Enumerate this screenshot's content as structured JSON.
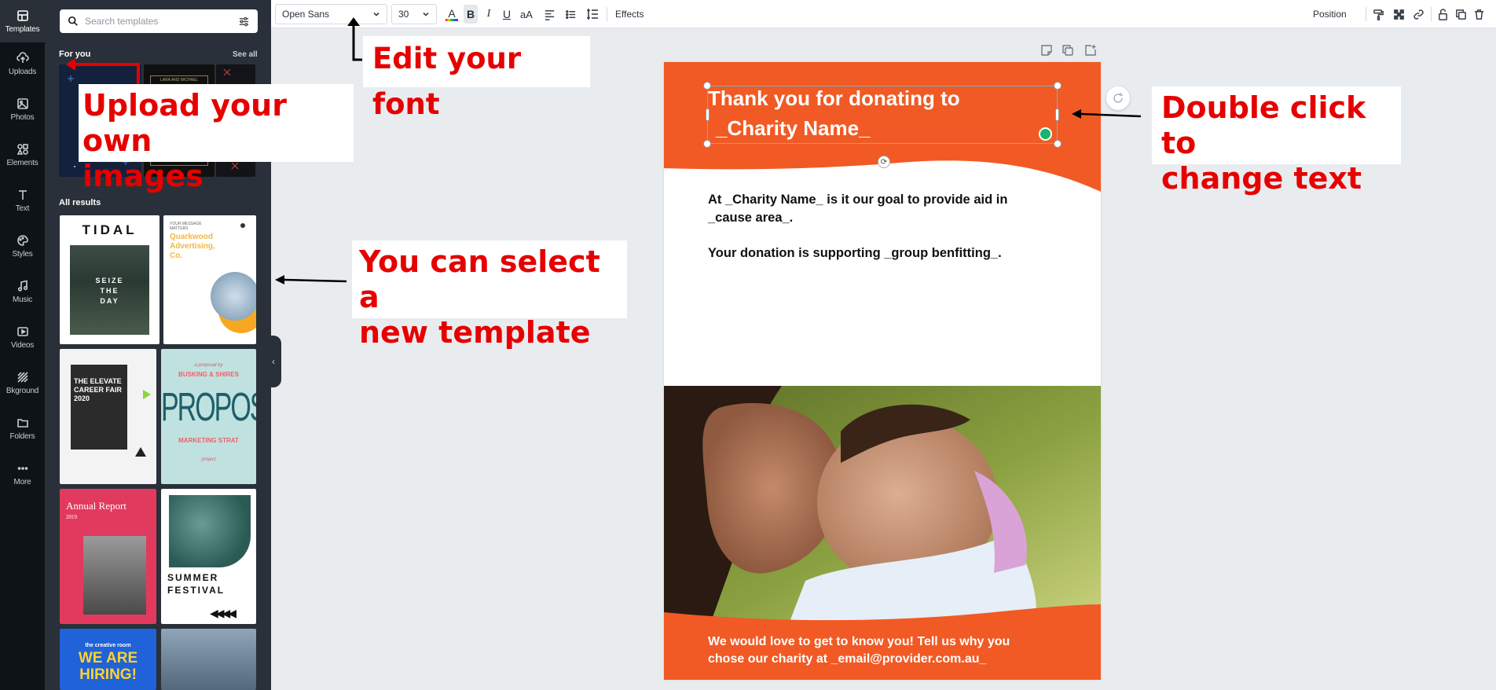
{
  "rail": {
    "items": [
      {
        "label": "Templates",
        "icon": "templates-icon"
      },
      {
        "label": "Uploads",
        "icon": "upload-icon"
      },
      {
        "label": "Photos",
        "icon": "photo-icon"
      },
      {
        "label": "Elements",
        "icon": "shapes-icon"
      },
      {
        "label": "Text",
        "icon": "text-icon"
      },
      {
        "label": "Styles",
        "icon": "palette-icon"
      },
      {
        "label": "Music",
        "icon": "music-icon"
      },
      {
        "label": "Videos",
        "icon": "video-icon"
      },
      {
        "label": "Bkground",
        "icon": "background-icon"
      },
      {
        "label": "Folders",
        "icon": "folder-icon"
      },
      {
        "label": "More",
        "icon": "more-icon"
      }
    ]
  },
  "panel": {
    "search_placeholder": "Search templates",
    "for_you": "For you",
    "see_all": "See all",
    "all_results": "All results",
    "thumb_small_text": "LARA AND MICHAEL",
    "templates": {
      "tidal": {
        "title": "TIDAL",
        "tagline1": "SEIZE",
        "tagline2": "THE",
        "tagline3": "DAY"
      },
      "quarkwood": {
        "kicker": "YOUR MESSAGE MATTERS",
        "name1": "Quarkwood",
        "name2": "Advertising,",
        "name3": "Co."
      },
      "career": {
        "line1": "THE ELEVATE",
        "line2": "CAREER FAIR",
        "line3": "2020"
      },
      "proposal": {
        "kicker": "a proposal by",
        "brand": "BUSKING & SHIRES",
        "title": "PROPOSAL",
        "subtitle": "MARKETING STRAT",
        "footer": "project"
      },
      "annual": {
        "title": "Annual Report",
        "year": "2019"
      },
      "summer": {
        "line1": "SUMMER",
        "line2": "FESTIVAL"
      },
      "hiring": {
        "kicker": "the creative room",
        "line1": "WE ARE",
        "line2": "HIRING!"
      }
    }
  },
  "toolbar": {
    "font": "Open Sans",
    "size": "30",
    "text_color_label": "A",
    "bold": "B",
    "italic": "I",
    "underline": "U",
    "case": "aA",
    "effects": "Effects",
    "position": "Position"
  },
  "page": {
    "header_line1": "Thank you for donating to",
    "header_line2": "_Charity Name_",
    "body_line1": "At _Charity Name_ is it our goal to provide aid in",
    "body_line2": "_cause area_.",
    "body_line3": "Your donation is supporting _group benfitting_.",
    "footer_line1": "We would love to get to know you! Tell us why you",
    "footer_line2": "chose our charity at _email@provider.com.au_",
    "accent_color": "#f15a24"
  },
  "annotations": {
    "font": "Edit your font",
    "upload_line1": "Upload your own",
    "upload_line2": "images",
    "template_line1": "You can select a",
    "template_line2": "new template",
    "text_line1": "Double click to",
    "text_line2": "change text"
  }
}
